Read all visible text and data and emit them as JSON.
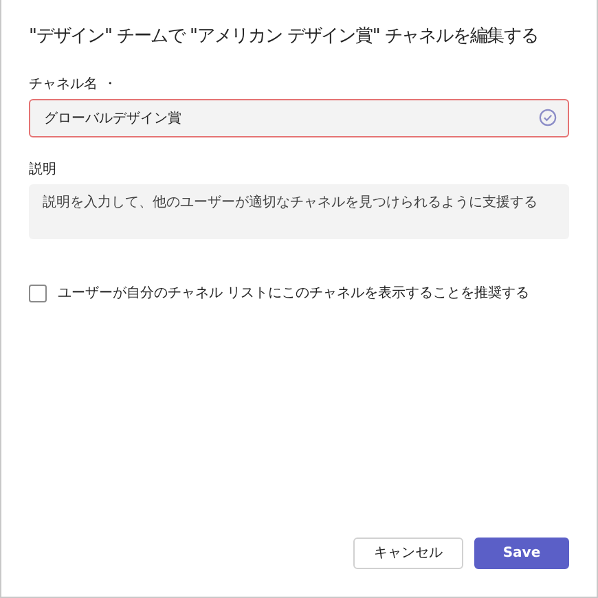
{
  "dialog": {
    "title": "\"デザイン\" チームで \"アメリカン デザイン賞\" チャネルを編集する"
  },
  "channel_name": {
    "label": "チャネル名",
    "required_mark": "・",
    "value": "グローバルデザイン賞",
    "invalid": true,
    "valid_check": true
  },
  "description": {
    "label": "説明",
    "placeholder": "説明を入力して、他のユーザーが適切なチャネルを見つけられるように支援する"
  },
  "recommend": {
    "label": "ユーザーが自分のチャネル リストにこのチャネルを表示することを推奨する",
    "checked": false
  },
  "buttons": [
    {
      "label": "キャンセル",
      "kind": "secondary"
    },
    {
      "label": "Save",
      "kind": "primary"
    }
  ]
}
